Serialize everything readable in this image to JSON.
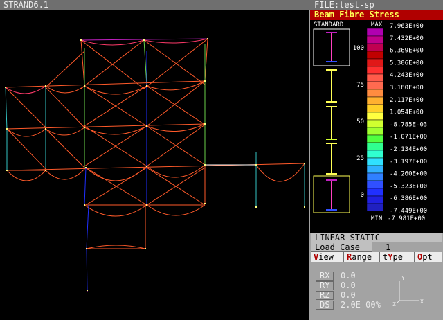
{
  "window": {
    "title": "STRAND6.1"
  },
  "side": {
    "file_title": "FILE:test-sp",
    "panel_title": "Beam Fibre Stress",
    "standard_label": "STANDARD",
    "max_label": "MAX",
    "min_label": "MIN",
    "percent_ticks": [
      "100",
      "75",
      "50",
      "25",
      "0"
    ],
    "scale_values": [
      "7.963E+00",
      "7.432E+00",
      "6.369E+00",
      "5.306E+00",
      "4.243E+00",
      "3.180E+00",
      "2.117E+00",
      "1.054E+00",
      "-8.785E-03",
      "-1.071E+00",
      "-2.134E+00",
      "-3.197E+00",
      "-4.260E+00",
      "-5.323E+00",
      "-6.386E+00",
      "-7.449E+00"
    ],
    "min_value": "-7.981E+00",
    "analysis": "LINEAR STATIC",
    "load_case_label": "Load Case",
    "load_case_value": "1",
    "menu": [
      {
        "hot": "V",
        "rest": "iew"
      },
      {
        "hot": "R",
        "rest": "ange"
      },
      {
        "pre": "t",
        "hot": "Y",
        "rest": "pe"
      },
      {
        "hot": "O",
        "rest": "pt"
      }
    ],
    "coords": [
      {
        "label": "RX",
        "value": "0.0"
      },
      {
        "label": "RY",
        "value": "0.0"
      },
      {
        "label": "RZ",
        "value": "0.0"
      },
      {
        "label": "DS",
        "value": "2.0E+00%"
      }
    ],
    "axes": {
      "y": "Y",
      "z": "Z",
      "x": "X"
    }
  },
  "colors": {
    "orange": "#ff5a2a",
    "pink": "#ff3a6a",
    "green": "#6ad24a",
    "yellow": "#ffff55",
    "cyan": "#34c4c4",
    "blue": "#2030ff",
    "magenta": "#c020c0",
    "scale": [
      "#b000b0",
      "#c0008a",
      "#c00050",
      "#c00000",
      "#e01818",
      "#ff3030",
      "#ff5a4a",
      "#ff6a50",
      "#ff8c40",
      "#ffb030",
      "#ffd028",
      "#ffff40",
      "#d0ff30",
      "#a0ff30",
      "#50ff40",
      "#30ff90",
      "#30ffd0",
      "#30e0ff",
      "#30b0ff",
      "#3080ff",
      "#3050ff",
      "#2030ff",
      "#2020e0",
      "#2020c0"
    ]
  }
}
